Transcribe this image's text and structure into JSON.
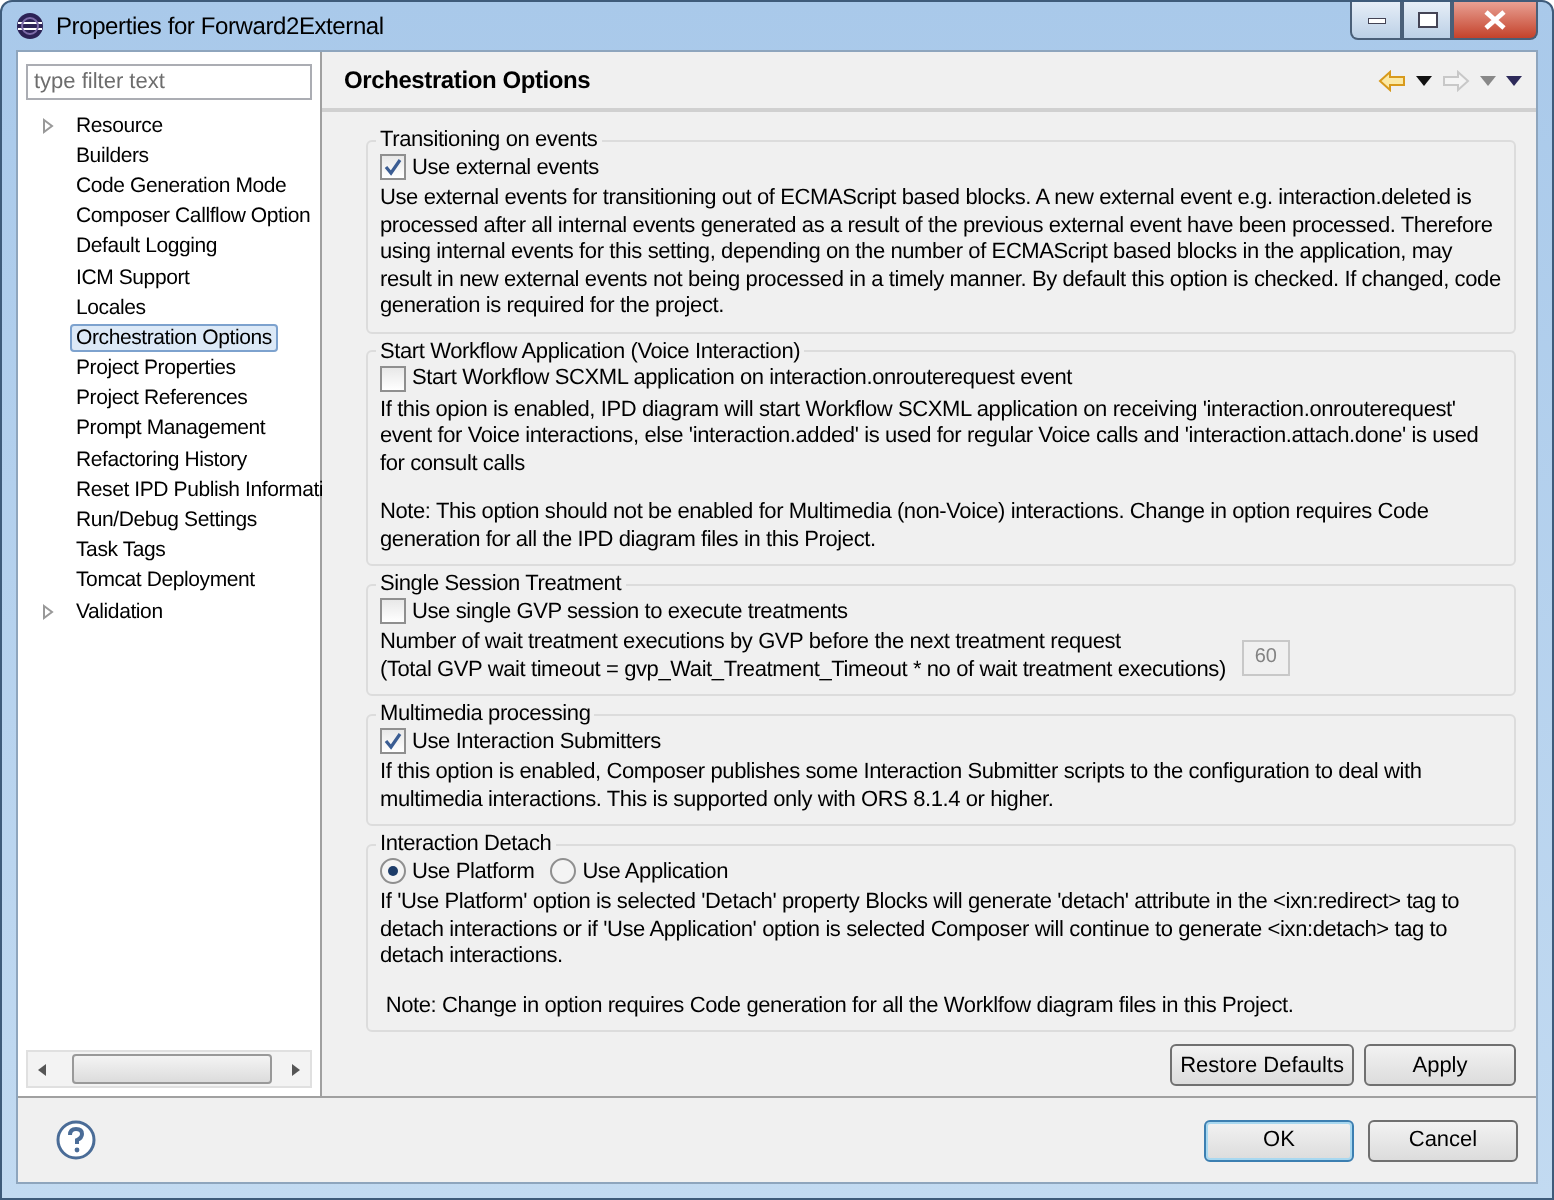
{
  "window": {
    "title": "Properties for Forward2External"
  },
  "sidebar": {
    "filter": {
      "placeholder": "type filter text"
    },
    "items": [
      {
        "label": "Resource",
        "expandable": true,
        "selected": false
      },
      {
        "label": "Builders",
        "expandable": false,
        "selected": false
      },
      {
        "label": "Code Generation Mode",
        "expandable": false,
        "selected": false
      },
      {
        "label": "Composer Callflow Option",
        "expandable": false,
        "selected": false
      },
      {
        "label": "Default Logging",
        "expandable": false,
        "selected": false
      },
      {
        "label": "ICM Support",
        "expandable": false,
        "selected": false
      },
      {
        "label": "Locales",
        "expandable": false,
        "selected": false
      },
      {
        "label": "Orchestration Options",
        "expandable": false,
        "selected": true
      },
      {
        "label": "Project Properties",
        "expandable": false,
        "selected": false
      },
      {
        "label": "Project References",
        "expandable": false,
        "selected": false
      },
      {
        "label": "Prompt Management",
        "expandable": false,
        "selected": false
      },
      {
        "label": "Refactoring History",
        "expandable": false,
        "selected": false
      },
      {
        "label": "Reset IPD Publish Informati",
        "expandable": false,
        "selected": false
      },
      {
        "label": "Run/Debug Settings",
        "expandable": false,
        "selected": false
      },
      {
        "label": "Task Tags",
        "expandable": false,
        "selected": false
      },
      {
        "label": "Tomcat Deployment",
        "expandable": false,
        "selected": false
      },
      {
        "label": "Validation",
        "expandable": true,
        "selected": false
      }
    ]
  },
  "page": {
    "title": "Orchestration Options",
    "groups": [
      {
        "title": "Transitioning on events",
        "controls": [
          {
            "kind": "checkbox",
            "label": "Use external events",
            "checked": true
          }
        ],
        "paragraphs": [
          "Use external events for transitioning out of ECMAScript based blocks. A new external event e.g. interaction.deleted is processed after all internal events generated as a result of the previous external event have been processed. Therefore using internal events for this setting, depending on the number of ECMAScript based blocks in the application, may result in new external events not being processed in a timely manner. By default this option is checked. If changed, code generation is required for the project."
        ]
      },
      {
        "title": "Start Workflow Application (Voice Interaction)",
        "controls": [
          {
            "kind": "checkbox",
            "label": "Start Workflow SCXML application on interaction.onrouterequest event",
            "checked": false
          }
        ],
        "paragraphs": [
          "If this opion is enabled, IPD diagram will start Workflow SCXML application on receiving 'interaction.onrouterequest' event for Voice interactions, else 'interaction.added' is used for regular Voice calls and 'interaction.attach.done' is used for consult calls",
          "Note: This option should not be enabled for Multimedia (non-Voice) interactions. Change in option requires Code generation for all the IPD diagram files in this Project."
        ]
      },
      {
        "title": "Single Session Treatment",
        "controls": [
          {
            "kind": "checkbox",
            "label": "Use single GVP session to execute treatments",
            "checked": false
          }
        ],
        "setting": {
          "lines": [
            "Number of wait treatment executions by GVP before the next treatment request",
            "(Total GVP wait timeout = gvp_Wait_Treatment_Timeout * no of wait treatment executions)"
          ],
          "value": "60",
          "disabled": true
        }
      },
      {
        "title": "Multimedia processing",
        "controls": [
          {
            "kind": "checkbox",
            "label": "Use Interaction Submitters",
            "checked": true
          }
        ],
        "paragraphs": [
          "If this option is enabled, Composer publishes some Interaction Submitter scripts to the configuration to deal with multimedia interactions. This is supported only with ORS 8.1.4 or higher."
        ]
      },
      {
        "title": "Interaction Detach",
        "controls": [
          {
            "kind": "radio",
            "label": "Use Platform",
            "selected": true
          },
          {
            "kind": "radio",
            "label": "Use Application",
            "selected": false
          }
        ],
        "paragraphs": [
          "If 'Use Platform' option is selected 'Detach' property Blocks will generate 'detach' attribute in the <ixn:redirect> tag to detach interactions or if 'Use Application' option is selected Composer will continue to generate <ixn:detach> tag to detach interactions.",
          " Note: Change in option requires Code generation for all the Worklfow diagram files in this Project."
        ]
      }
    ],
    "buttons": [
      "Restore Defaults",
      "Apply"
    ]
  },
  "footer": {
    "buttons": [
      {
        "label": "OK",
        "default": true
      },
      {
        "label": "Cancel",
        "default": false
      }
    ]
  }
}
